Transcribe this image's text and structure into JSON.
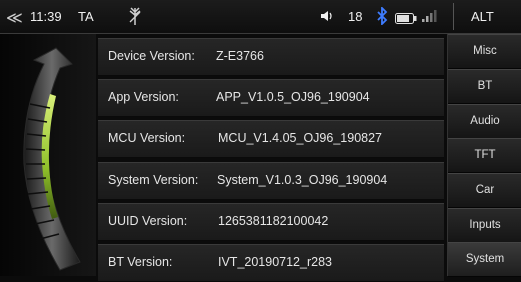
{
  "status": {
    "time": "11:39",
    "ta": "TA",
    "volume": "18",
    "alt": "ALT"
  },
  "rows": [
    {
      "label": "Device Version:",
      "value": "Z-E3766"
    },
    {
      "label": "App Version:",
      "value": "APP_V1.0.5_OJ96_190904"
    },
    {
      "label": "MCU Version:",
      "value": "MCU_V1.4.05_OJ96_190827"
    },
    {
      "label": "System Version:",
      "value": "System_V1.0.3_OJ96_190904"
    },
    {
      "label": "UUID Version:",
      "value": "1265381182100042"
    },
    {
      "label": "BT Version:",
      "value": "IVT_20190712_r283"
    }
  ],
  "tabs": [
    "Misc",
    "BT",
    "Audio",
    "TFT",
    "Car",
    "Inputs",
    "System"
  ],
  "colors": {
    "accent": "#9ccc3a",
    "background": "#0b0b0b"
  }
}
